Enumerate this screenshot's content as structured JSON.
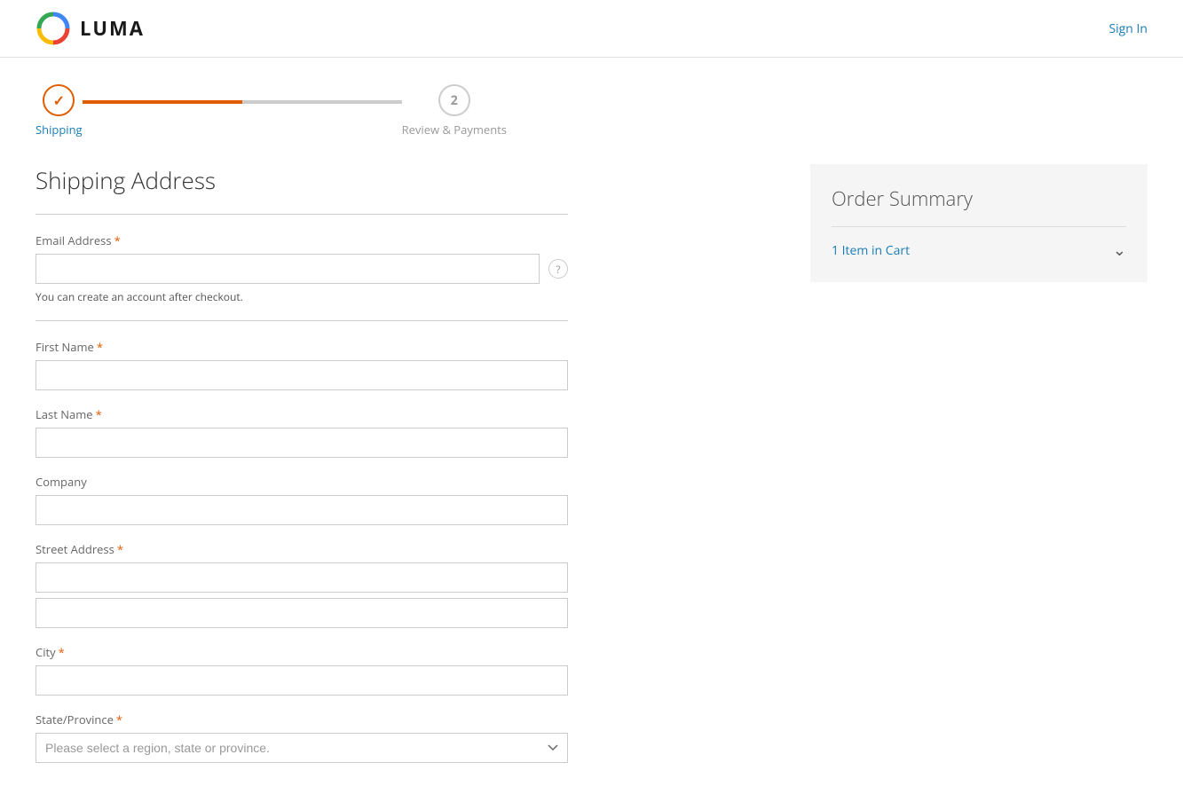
{
  "header": {
    "logo_text": "LUMA",
    "sign_in_label": "Sign In"
  },
  "progress": {
    "step1_label": "Shipping",
    "step2_label": "Review & Payments",
    "step2_number": "2"
  },
  "form": {
    "page_title": "Shipping Address",
    "email_label": "Email Address",
    "email_required": "*",
    "email_hint": "You can create an account after checkout.",
    "email_hint_link": "checkout",
    "firstname_label": "First Name",
    "firstname_required": "*",
    "lastname_label": "Last Name",
    "lastname_required": "*",
    "company_label": "Company",
    "street_label": "Street Address",
    "street_required": "*",
    "city_label": "City",
    "city_required": "*",
    "state_label": "State/Province",
    "state_required": "*",
    "state_placeholder": "Please select a region, state or province."
  },
  "order_summary": {
    "title": "Order Summary",
    "cart_label": "1 Item in Cart"
  }
}
